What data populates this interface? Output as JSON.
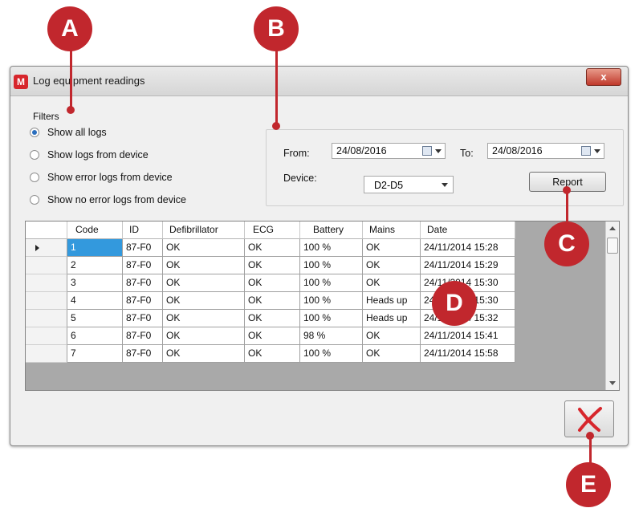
{
  "window": {
    "title": "Log equipment readings",
    "close_label": "x",
    "app_icon_letter": "M"
  },
  "filters": {
    "label": "Filters",
    "options": [
      {
        "label": "Show all logs",
        "checked": true
      },
      {
        "label": "Show logs from device",
        "checked": false
      },
      {
        "label": "Show error logs from device",
        "checked": false
      },
      {
        "label": "Show no error logs from device",
        "checked": false
      }
    ]
  },
  "range": {
    "from_label": "From:",
    "from_value": "24/08/2016",
    "to_label": "To:",
    "to_value": "24/08/2016",
    "device_label": "Device:",
    "device_value": "D2-D5",
    "report_label": "Report"
  },
  "table": {
    "columns": [
      "Code",
      "ID",
      "Defibrillator",
      "ECG",
      "Battery",
      "Mains",
      "Date"
    ],
    "rows": [
      [
        "1",
        "87-F0",
        "OK",
        "OK",
        "100 %",
        "OK",
        "24/11/2014 15:28"
      ],
      [
        "2",
        "87-F0",
        "OK",
        "OK",
        "100 %",
        "OK",
        "24/11/2014 15:29"
      ],
      [
        "3",
        "87-F0",
        "OK",
        "OK",
        "100 %",
        "OK",
        "24/11/2014 15:30"
      ],
      [
        "4",
        "87-F0",
        "OK",
        "OK",
        "100 %",
        "Heads up",
        "24/11/2014 15:30"
      ],
      [
        "5",
        "87-F0",
        "OK",
        "OK",
        "100 %",
        "Heads up",
        "24/11/2014 15:32"
      ],
      [
        "6",
        "87-F0",
        "OK",
        "OK",
        "98 %",
        "OK",
        "24/11/2014 15:41"
      ],
      [
        "7",
        "87-F0",
        "OK",
        "OK",
        "100 %",
        "OK",
        "24/11/2014 15:58"
      ]
    ]
  },
  "callouts": [
    "A",
    "B",
    "C",
    "D",
    "E"
  ],
  "colors": {
    "callout": "#c1272d",
    "selection": "#3399dd",
    "exit_x": "#d7262c"
  }
}
